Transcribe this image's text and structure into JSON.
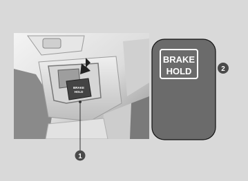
{
  "figure": {
    "indicator_label_line1": "BRAKE",
    "indicator_label_line2": "HOLD",
    "switch_label_line1": "BRAKE",
    "switch_label_line2": "HOLD",
    "callouts": [
      "1",
      "2"
    ]
  },
  "colors": {
    "background": "#d9d9d9",
    "photo_light": "#f2f2f2",
    "photo_dark": "#6f6f6f",
    "indicator_panel": "#6b6b6b",
    "callout_fill": "#4a4a4a",
    "label_text": "#ffffff"
  }
}
